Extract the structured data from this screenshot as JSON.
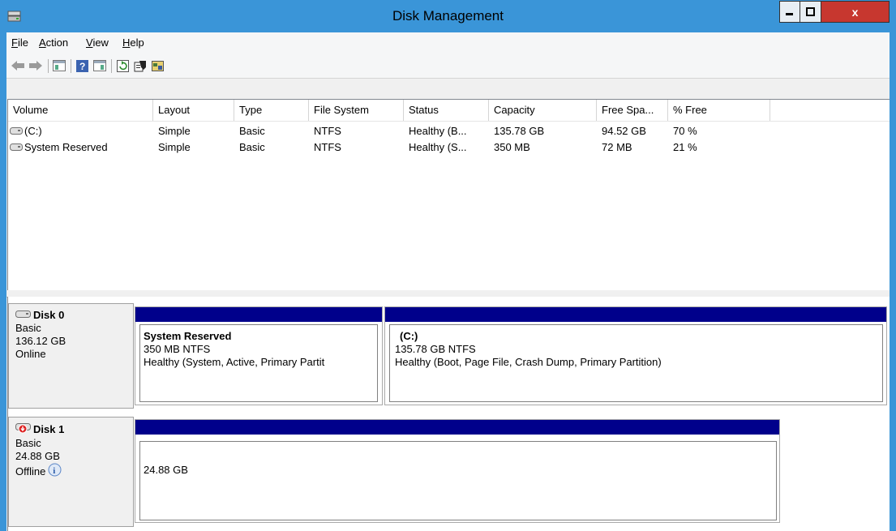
{
  "window": {
    "title": "Disk Management",
    "close_label": "x"
  },
  "menu": [
    {
      "hot": "F",
      "rest": "ile"
    },
    {
      "hot": "A",
      "rest": "ction"
    },
    {
      "hot": "V",
      "rest": "iew"
    },
    {
      "hot": "H",
      "rest": "elp"
    }
  ],
  "toolbar_icons": [
    "back-arrow-icon",
    "forward-arrow-icon",
    "show-hide-console-tree-icon",
    "help-icon",
    "show-hide-action-pane-icon",
    "refresh-icon",
    "properties-icon",
    "rescan-disks-icon"
  ],
  "columns": [
    "Volume",
    "Layout",
    "Type",
    "File System",
    "Status",
    "Capacity",
    "Free Spa...",
    "% Free"
  ],
  "volumes": [
    {
      "volume": "(C:)",
      "layout": "Simple",
      "type": "Basic",
      "fs": "NTFS",
      "status": "Healthy (B...",
      "capacity": "135.78 GB",
      "free": "94.52 GB",
      "pct": "70 %"
    },
    {
      "volume": "System Reserved",
      "layout": "Simple",
      "type": "Basic",
      "fs": "NTFS",
      "status": "Healthy (S...",
      "capacity": "350 MB",
      "free": "72 MB",
      "pct": "21 %"
    }
  ],
  "disks": [
    {
      "name": "Disk 0",
      "type": "Basic",
      "size": "136.12 GB",
      "state": "Online",
      "partitions": [
        {
          "name": "System Reserved",
          "detail": "350 MB NTFS",
          "status": "Healthy (System, Active, Primary Partit"
        },
        {
          "name": "(C:)",
          "detail": "135.78 GB NTFS",
          "status": "Healthy (Boot, Page File, Crash Dump, Primary Partition)"
        }
      ]
    },
    {
      "name": "Disk 1",
      "type": "Basic",
      "size": "24.88 GB",
      "state": "Offline",
      "partitions": [
        {
          "detail": "24.88 GB"
        }
      ]
    }
  ],
  "colors": {
    "titlebar": "#3a95d8",
    "partition_bar": "#00008b",
    "close_button": "#c7372f"
  }
}
